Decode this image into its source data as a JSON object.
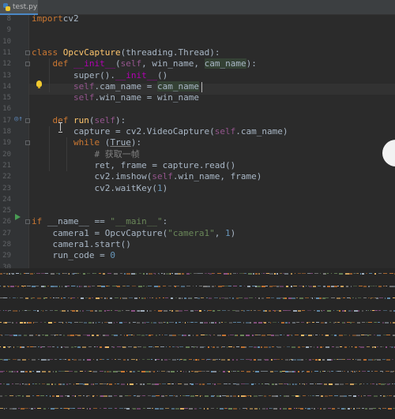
{
  "tab": {
    "label": "test.py"
  },
  "lines": [
    {
      "n": "8",
      "tokens": [
        [
          "kw",
          "import"
        ],
        [
          "",
          "cv2"
        ]
      ]
    },
    {
      "n": "9",
      "tokens": []
    },
    {
      "n": "10",
      "tokens": []
    },
    {
      "n": "11",
      "tokens": [
        [
          "kw",
          "class "
        ],
        [
          "fn",
          "OpcvCapture"
        ],
        [
          "",
          "(threading.Thread):"
        ]
      ]
    },
    {
      "n": "12",
      "tokens": [
        [
          "",
          "    "
        ],
        [
          "kw",
          "def "
        ],
        [
          "magic",
          "__init__"
        ],
        [
          "",
          "("
        ],
        [
          "self",
          "self"
        ],
        [
          "",
          ", win_name, "
        ],
        [
          "hl",
          "cam_name"
        ],
        [
          "",
          "):"
        ]
      ]
    },
    {
      "n": "13",
      "tokens": [
        [
          "",
          "        super()."
        ],
        [
          "magic",
          "__init__"
        ],
        [
          "",
          "()"
        ]
      ]
    },
    {
      "n": "14",
      "tokens": [
        [
          "",
          "        "
        ],
        [
          "self",
          "self"
        ],
        [
          "",
          ".cam_name = "
        ],
        [
          "hl",
          "cam_name"
        ]
      ]
    },
    {
      "n": "15",
      "tokens": [
        [
          "",
          "        "
        ],
        [
          "self",
          "self"
        ],
        [
          "",
          ".win_name = win_name"
        ]
      ]
    },
    {
      "n": "16",
      "tokens": []
    },
    {
      "n": "17",
      "tokens": [
        [
          "",
          "    "
        ],
        [
          "kw",
          "def "
        ],
        [
          "fn",
          "run"
        ],
        [
          "",
          "("
        ],
        [
          "self",
          "self"
        ],
        [
          "",
          "):"
        ]
      ]
    },
    {
      "n": "18",
      "tokens": [
        [
          "",
          "        capture = cv2.VideoCapture("
        ],
        [
          "self",
          "self"
        ],
        [
          "",
          ".cam_name)"
        ]
      ]
    },
    {
      "n": "19",
      "tokens": [
        [
          "",
          "        "
        ],
        [
          "kw",
          "while "
        ],
        [
          "",
          "("
        ],
        [
          "u",
          "True"
        ],
        [
          "",
          "):"
        ]
      ]
    },
    {
      "n": "20",
      "tokens": [
        [
          "",
          "            "
        ],
        [
          "cmt",
          "# 获取一帧"
        ]
      ]
    },
    {
      "n": "21",
      "tokens": [
        [
          "",
          "            ret, frame = capture.read()"
        ]
      ]
    },
    {
      "n": "22",
      "tokens": [
        [
          "",
          "            cv2.imshow("
        ],
        [
          "self",
          "self"
        ],
        [
          "",
          ".win_name, frame)"
        ]
      ]
    },
    {
      "n": "23",
      "tokens": [
        [
          "",
          "            cv2.waitKey("
        ],
        [
          "num",
          "1"
        ],
        [
          "",
          ")"
        ]
      ]
    },
    {
      "n": "24",
      "tokens": []
    },
    {
      "n": "25",
      "tokens": []
    },
    {
      "n": "26",
      "tokens": [
        [
          "kw",
          "if "
        ],
        [
          "",
          "__name__ == "
        ],
        [
          "str",
          "\"__main__\""
        ],
        [
          "",
          ":"
        ]
      ]
    },
    {
      "n": "27",
      "tokens": [
        [
          "",
          "    camera1 = OpcvCapture("
        ],
        [
          "str",
          "\"camera1\""
        ],
        [
          "",
          ", "
        ],
        [
          "num",
          "1"
        ],
        [
          "",
          ")"
        ]
      ]
    },
    {
      "n": "28",
      "tokens": [
        [
          "",
          "    camera1.start()"
        ]
      ]
    },
    {
      "n": "29",
      "tokens": [
        [
          "",
          "    run_code = "
        ],
        [
          "num",
          "0"
        ]
      ]
    },
    {
      "n": "30",
      "tokens": []
    }
  ],
  "colors": {
    "background": "#2b2b2b",
    "keyword": "#cc7832",
    "function": "#ffc66d",
    "self": "#94558d",
    "string": "#6a8759",
    "number": "#6897bb",
    "comment": "#808080"
  },
  "icons": {
    "tab": "python-file-icon",
    "line14": "intention-bulb-icon",
    "line17": "override-marker-icon",
    "line26": "run-gutter-icon"
  }
}
